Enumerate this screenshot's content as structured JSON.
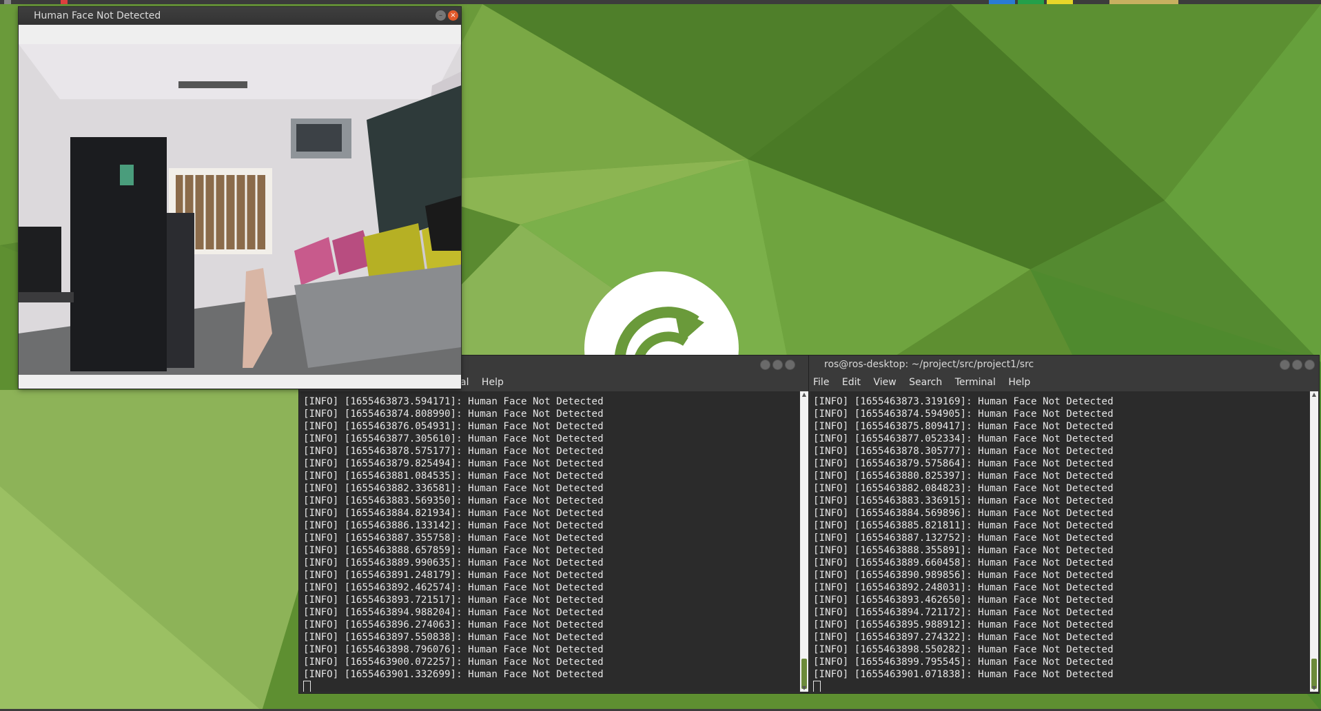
{
  "camera_window": {
    "title": "Human Face Not Detected"
  },
  "terminal_left": {
    "menu_visible": [
      "al",
      "Help"
    ],
    "lines": [
      "[INFO] [1655463873.594171]: Human Face Not Detected",
      "[INFO] [1655463874.808990]: Human Face Not Detected",
      "[INFO] [1655463876.054931]: Human Face Not Detected",
      "[INFO] [1655463877.305610]: Human Face Not Detected",
      "[INFO] [1655463878.575177]: Human Face Not Detected",
      "[INFO] [1655463879.825494]: Human Face Not Detected",
      "[INFO] [1655463881.084535]: Human Face Not Detected",
      "[INFO] [1655463882.336581]: Human Face Not Detected",
      "[INFO] [1655463883.569350]: Human Face Not Detected",
      "[INFO] [1655463884.821934]: Human Face Not Detected",
      "[INFO] [1655463886.133142]: Human Face Not Detected",
      "[INFO] [1655463887.355758]: Human Face Not Detected",
      "[INFO] [1655463888.657859]: Human Face Not Detected",
      "[INFO] [1655463889.990635]: Human Face Not Detected",
      "[INFO] [1655463891.248179]: Human Face Not Detected",
      "[INFO] [1655463892.462574]: Human Face Not Detected",
      "[INFO] [1655463893.721517]: Human Face Not Detected",
      "[INFO] [1655463894.988204]: Human Face Not Detected",
      "[INFO] [1655463896.274063]: Human Face Not Detected",
      "[INFO] [1655463897.550838]: Human Face Not Detected",
      "[INFO] [1655463898.796076]: Human Face Not Detected",
      "[INFO] [1655463900.072257]: Human Face Not Detected",
      "[INFO] [1655463901.332699]: Human Face Not Detected"
    ]
  },
  "terminal_right": {
    "title": "ros@ros-desktop: ~/project/src/project1/src",
    "menu": [
      "File",
      "Edit",
      "View",
      "Search",
      "Terminal",
      "Help"
    ],
    "lines": [
      "[INFO] [1655463873.319169]: Human Face Not Detected",
      "[INFO] [1655463874.594905]: Human Face Not Detected",
      "[INFO] [1655463875.809417]: Human Face Not Detected",
      "[INFO] [1655463877.052334]: Human Face Not Detected",
      "[INFO] [1655463878.305777]: Human Face Not Detected",
      "[INFO] [1655463879.575864]: Human Face Not Detected",
      "[INFO] [1655463880.825397]: Human Face Not Detected",
      "[INFO] [1655463882.084823]: Human Face Not Detected",
      "[INFO] [1655463883.336915]: Human Face Not Detected",
      "[INFO] [1655463884.569896]: Human Face Not Detected",
      "[INFO] [1655463885.821811]: Human Face Not Detected",
      "[INFO] [1655463887.132752]: Human Face Not Detected",
      "[INFO] [1655463888.355891]: Human Face Not Detected",
      "[INFO] [1655463889.660458]: Human Face Not Detected",
      "[INFO] [1655463890.989856]: Human Face Not Detected",
      "[INFO] [1655463892.248031]: Human Face Not Detected",
      "[INFO] [1655463893.462650]: Human Face Not Detected",
      "[INFO] [1655463894.721172]: Human Face Not Detected",
      "[INFO] [1655463895.988912]: Human Face Not Detected",
      "[INFO] [1655463897.274322]: Human Face Not Detected",
      "[INFO] [1655463898.550282]: Human Face Not Detected",
      "[INFO] [1655463899.795545]: Human Face Not Detected",
      "[INFO] [1655463901.071838]: Human Face Not Detected"
    ]
  },
  "colors": {
    "desktop_green": "#5f8e33",
    "terminal_bg": "#2b2b2b",
    "close_button": "#e05a2b"
  },
  "icons": {
    "desktop_logo": "ubuntu-mate-logo-icon"
  }
}
